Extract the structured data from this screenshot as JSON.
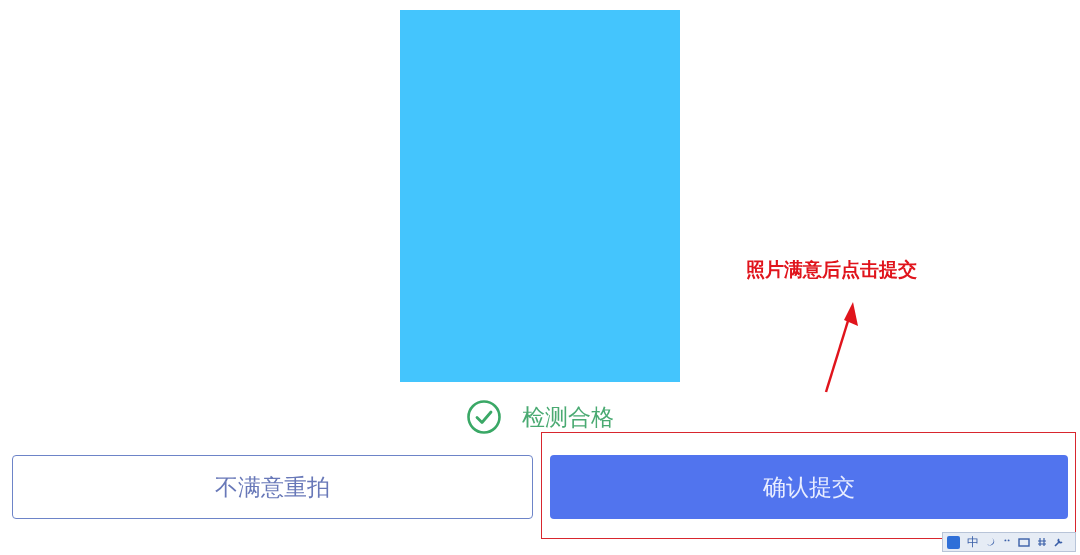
{
  "status": {
    "text": "检测合格",
    "passed": true
  },
  "buttons": [
    {
      "label": "不满意重拍",
      "kind": "outline"
    },
    {
      "label": "确认提交",
      "kind": "primary"
    }
  ],
  "annotation": {
    "text": "照片满意后点击提交"
  },
  "ime_toolbar": {
    "mode": "中"
  }
}
